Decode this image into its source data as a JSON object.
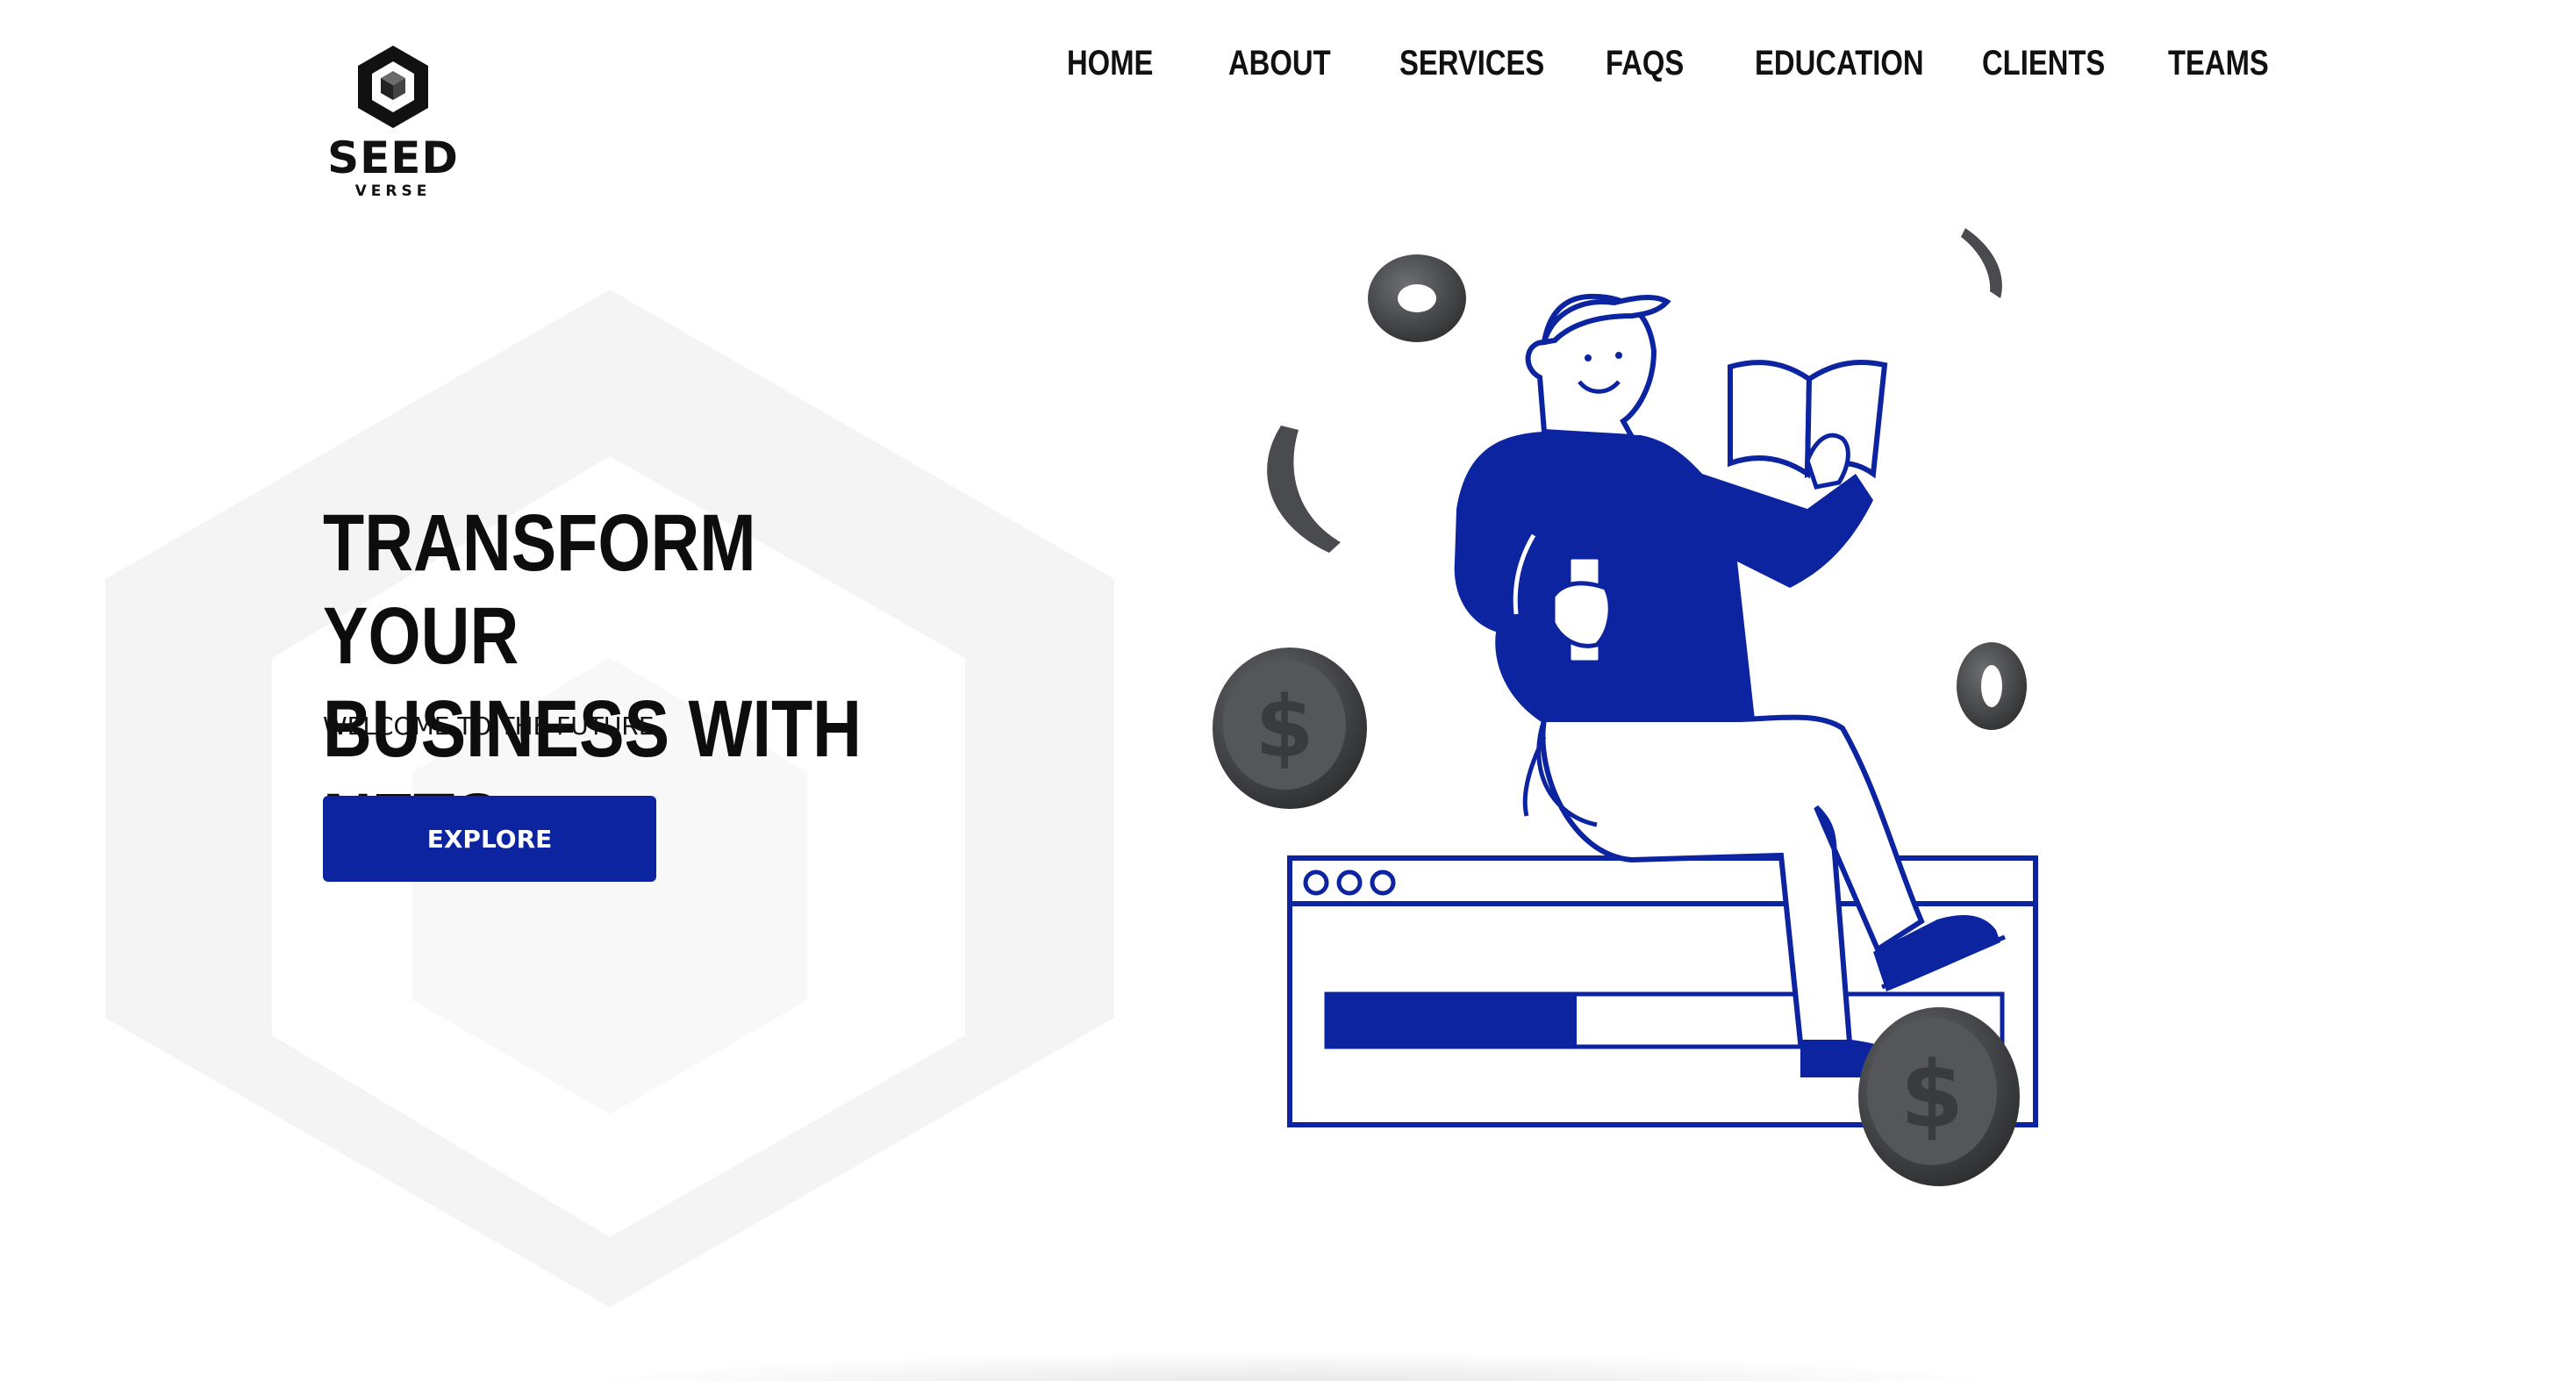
{
  "brand": {
    "name": "SEED",
    "sub": "VERSE",
    "logo_icon": "hexagon-cube-icon"
  },
  "nav": {
    "items": [
      "HOME",
      "ABOUT",
      "SERVICES",
      "FAQS",
      "EDUCATION",
      "CLIENTS",
      "TEAMS"
    ]
  },
  "hero": {
    "title_line1": "TRANSFORM YOUR",
    "title_line2": "BUSINESS WITH NFTS",
    "subtitle": "WELCOME TO THE FUTURE",
    "cta_label": "EXPLORE"
  },
  "illustration": {
    "subject": "person-reading-book-on-browser-window-icon",
    "accent_color": "#0d24a0",
    "coin_color": "#4a4b4e",
    "progress": 0.37
  },
  "colors": {
    "accent": "#0d24a0",
    "text": "#111111",
    "background": "#ffffff",
    "hex_bg": "#f3f3f4"
  }
}
